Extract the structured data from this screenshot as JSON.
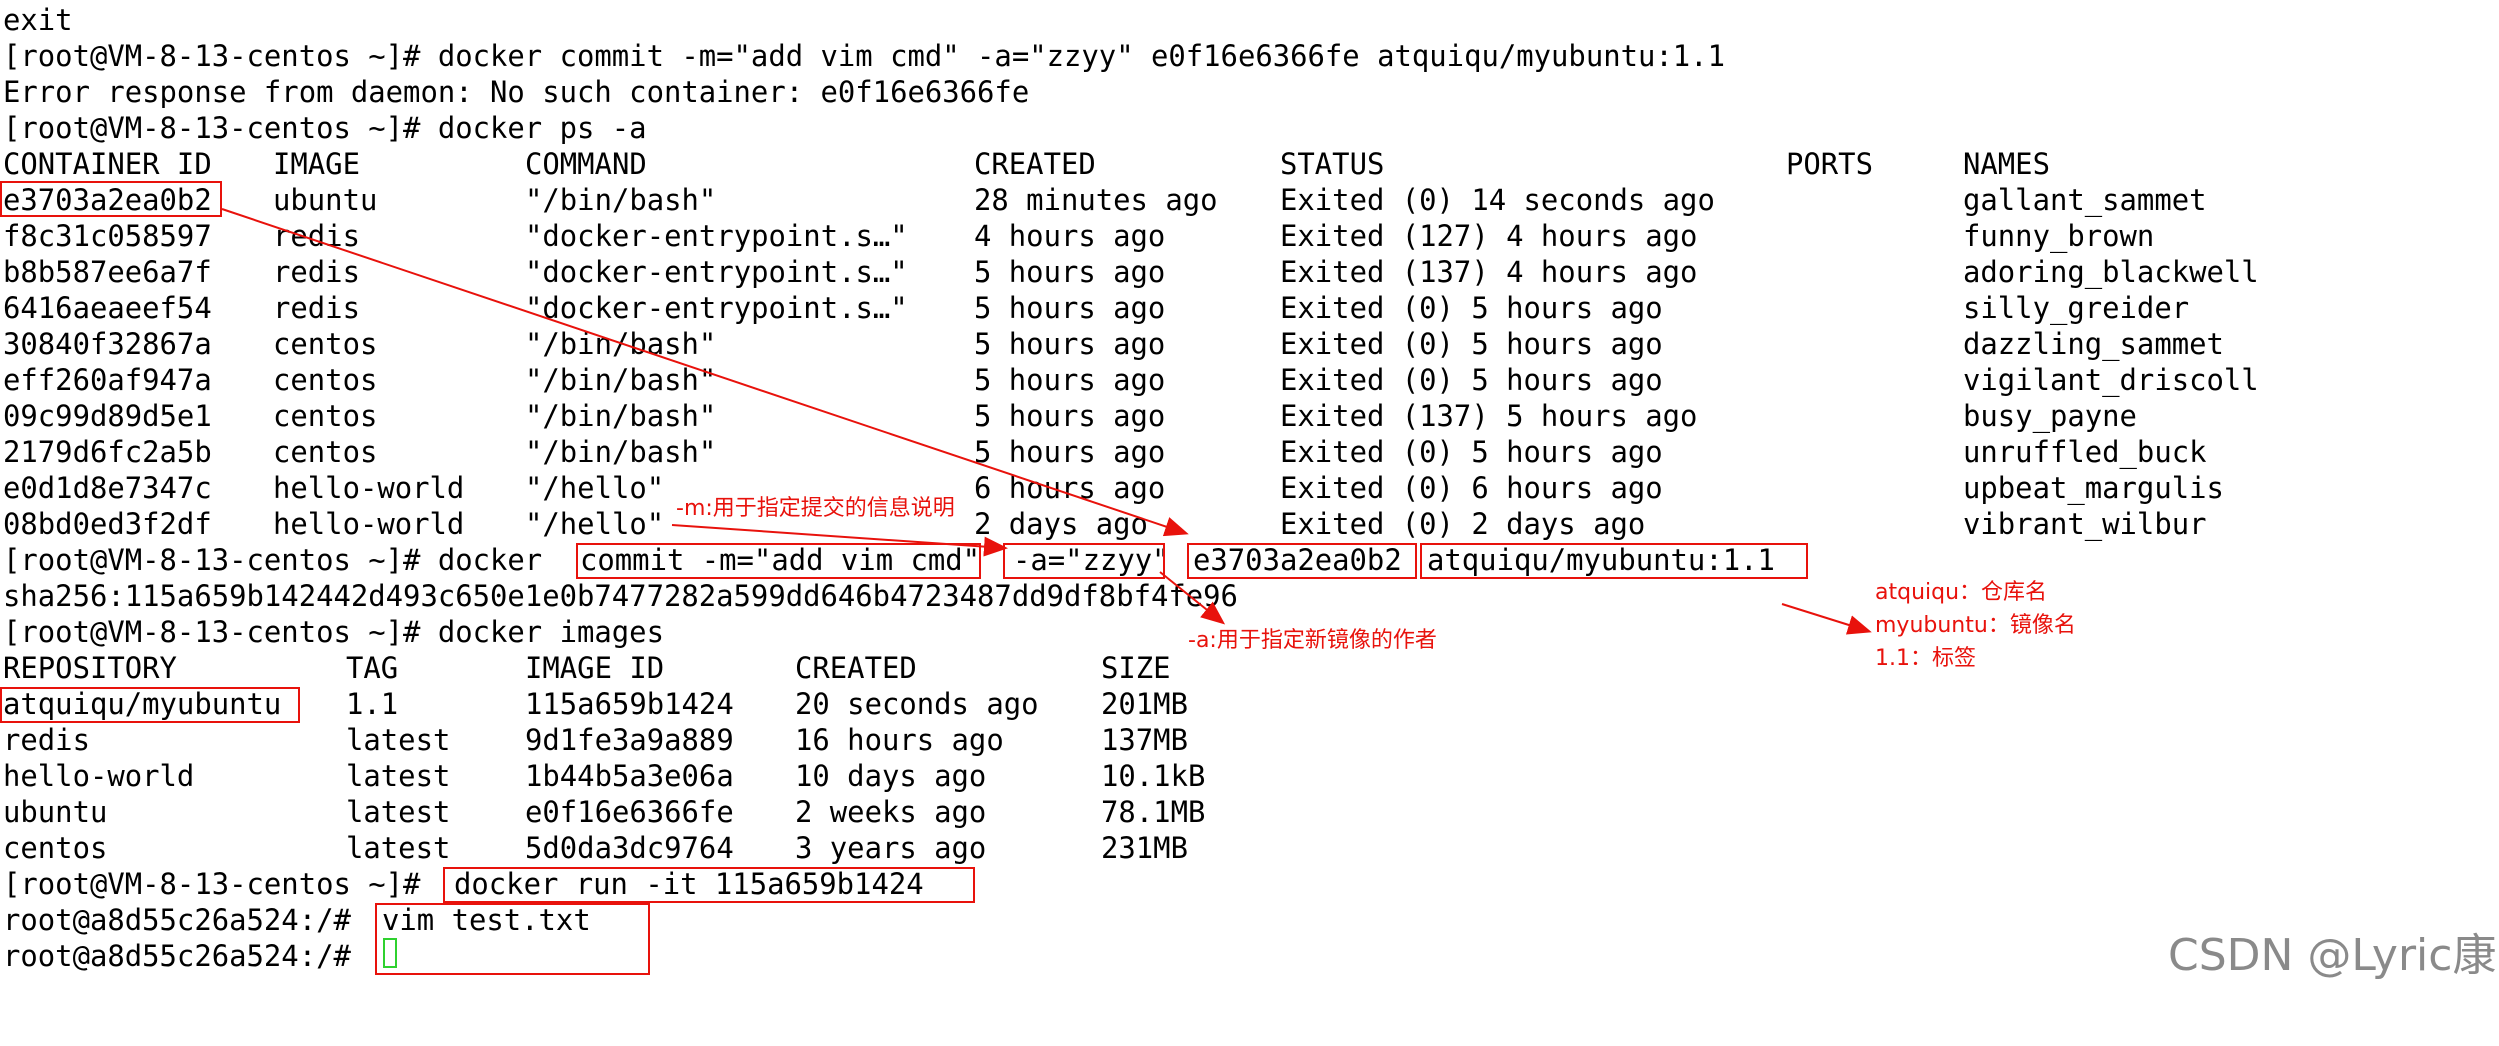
{
  "lines": [
    {
      "text": "exit"
    },
    {
      "text": "[root@VM-8-13-centos ~]# docker commit -m=\"add vim cmd\" -a=\"zzyy\" e0f16e6366fe atquiqu/myubuntu:1.1"
    },
    {
      "text": "Error response from daemon: No such container: e0f16e6366fe"
    },
    {
      "text": "[root@VM-8-13-centos ~]# docker ps -a"
    }
  ],
  "ps_table": {
    "headers": [
      "CONTAINER ID",
      "IMAGE",
      "COMMAND",
      "CREATED",
      "STATUS",
      "PORTS",
      "NAMES"
    ],
    "rows": [
      [
        "e3703a2ea0b2",
        "ubuntu",
        "\"/bin/bash\"",
        "28 minutes ago",
        "Exited (0) 14 seconds ago",
        "",
        "gallant_sammet"
      ],
      [
        "f8c31c058597",
        "redis",
        "\"docker-entrypoint.s…\"",
        "4 hours ago",
        "Exited (127) 4 hours ago",
        "",
        "funny_brown"
      ],
      [
        "b8b587ee6a7f",
        "redis",
        "\"docker-entrypoint.s…\"",
        "5 hours ago",
        "Exited (137) 4 hours ago",
        "",
        "adoring_blackwell"
      ],
      [
        "6416aeaeef54",
        "redis",
        "\"docker-entrypoint.s…\"",
        "5 hours ago",
        "Exited (0) 5 hours ago",
        "",
        "silly_greider"
      ],
      [
        "30840f32867a",
        "centos",
        "\"/bin/bash\"",
        "5 hours ago",
        "Exited (0) 5 hours ago",
        "",
        "dazzling_sammet"
      ],
      [
        "eff260af947a",
        "centos",
        "\"/bin/bash\"",
        "5 hours ago",
        "Exited (0) 5 hours ago",
        "",
        "vigilant_driscoll"
      ],
      [
        "09c99d89d5e1",
        "centos",
        "\"/bin/bash\"",
        "5 hours ago",
        "Exited (137) 5 hours ago",
        "",
        "busy_payne"
      ],
      [
        "2179d6fc2a5b",
        "centos",
        "\"/bin/bash\"",
        "5 hours ago",
        "Exited (0) 5 hours ago",
        "",
        "unruffled_buck"
      ],
      [
        "e0d1d8e7347c",
        "hello-world",
        "\"/hello\"",
        "6 hours ago",
        "Exited (0) 6 hours ago",
        "",
        "upbeat_margulis"
      ],
      [
        "08bd0ed3f2df",
        "hello-world",
        "\"/hello\"",
        "2 days ago",
        "Exited (0) 2 days ago",
        "",
        "vibrant_wilbur"
      ]
    ]
  },
  "commit_cmd": {
    "prompt": "[root@VM-8-13-centos ~]# docker ",
    "commit_part": "commit -m=\"add vim cmd\"",
    "author_part": "-a=\"zzyy\"",
    "container_id": "e3703a2ea0b2",
    "image_tag": "atquiqu/myubuntu:1.1"
  },
  "sha_line": "sha256:115a659b142442d493c650e1e0b7477282a599dd646b4723487dd9df8bf4fe96",
  "images_cmd": "[root@VM-8-13-centos ~]# docker images",
  "images_table": {
    "headers": [
      "REPOSITORY",
      "TAG",
      "IMAGE ID",
      "CREATED",
      "SIZE"
    ],
    "rows": [
      [
        "atquiqu/myubuntu",
        "1.1",
        "115a659b1424",
        "20 seconds ago",
        "201MB"
      ],
      [
        "redis",
        "latest",
        "9d1fe3a9a889",
        "16 hours ago",
        "137MB"
      ],
      [
        "hello-world",
        "latest",
        "1b44b5a3e06a",
        "10 days ago",
        "10.1kB"
      ],
      [
        "ubuntu",
        "latest",
        "e0f16e6366fe",
        "2 weeks ago",
        "78.1MB"
      ],
      [
        "centos",
        "latest",
        "5d0da3dc9764",
        "3 years ago",
        "231MB"
      ]
    ]
  },
  "run_cmd": {
    "prompt": "[root@VM-8-13-centos ~]#",
    "command": "docker run -it 115a659b1424"
  },
  "vim_line": {
    "prompt": "root@a8d55c26a524:/#",
    "command": "vim test.txt"
  },
  "last_line": {
    "prompt": "root@a8d55c26a524:/#"
  },
  "annotations": {
    "m_note": "-m:用于指定提交的信息说明",
    "a_note": "-a:用于指定新镜像的作者",
    "tag_notes": [
      "atquiqu：仓库名",
      "myubuntu：镜像名",
      "1.1：标签"
    ]
  },
  "colors": {
    "highlight": "#e8120c",
    "cursor": "#2fd12f",
    "text": "#000000",
    "background": "#ffffff"
  },
  "watermark": "CSDN @Lyric康"
}
